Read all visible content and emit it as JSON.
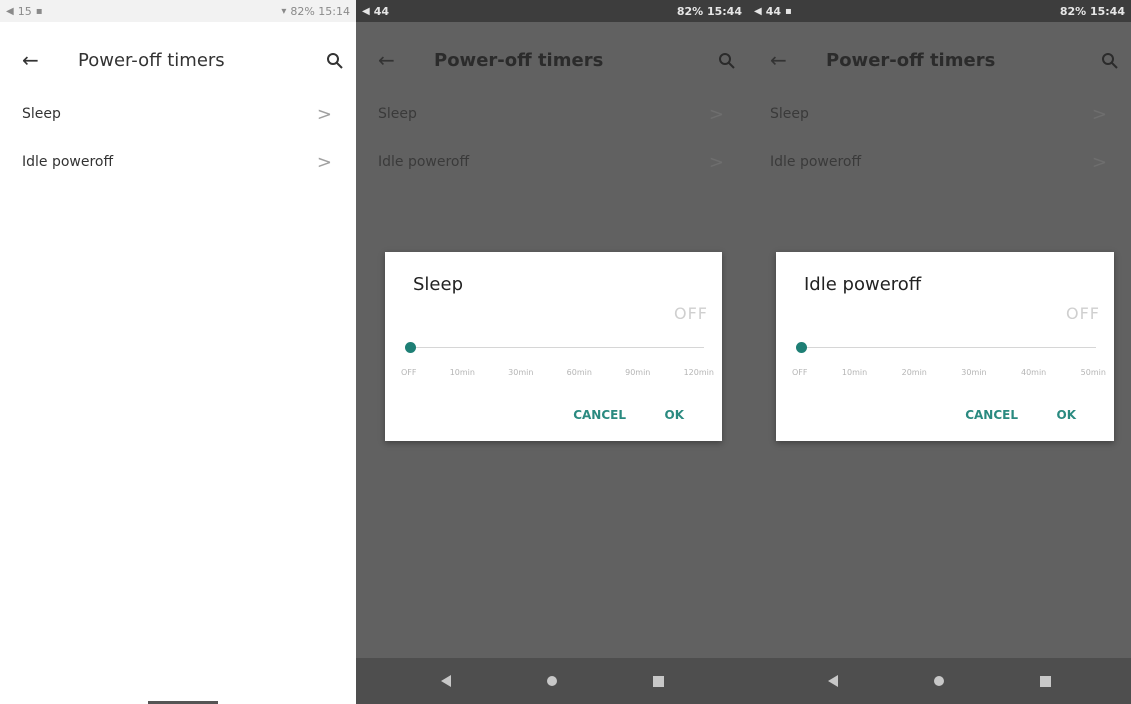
{
  "screens": [
    {
      "status": {
        "left": "15",
        "right": "82% 15:14"
      },
      "title": "Power-off timers",
      "rows": [
        "Sleep",
        "Idle poweroff"
      ]
    },
    {
      "status": {
        "left": "44",
        "right": "82% 15:44"
      },
      "title": "Power-off timers",
      "rows": [
        "Sleep",
        "Idle poweroff"
      ],
      "dialog": {
        "title": "Sleep",
        "value": "OFF",
        "slider_level": 0,
        "ticks": [
          "OFF",
          "10min",
          "30min",
          "60min",
          "90min",
          "120min"
        ],
        "cancel": "CANCEL",
        "ok": "OK"
      }
    },
    {
      "status": {
        "left": "44",
        "right": "82% 15:44"
      },
      "title": "Power-off timers",
      "rows": [
        "Sleep",
        "Idle poweroff"
      ],
      "dialog": {
        "title": "Idle poweroff",
        "value": "OFF",
        "slider_level": 0,
        "ticks": [
          "OFF",
          "10min",
          "20min",
          "30min",
          "40min",
          "50min"
        ],
        "cancel": "CANCEL",
        "ok": "OK"
      }
    }
  ],
  "icons": {
    "back": "arrow-left-icon",
    "search": "search-icon",
    "chevron": "chevron-right-icon",
    "nav": [
      "nav-back-icon",
      "nav-home-icon",
      "nav-recents-icon"
    ]
  },
  "colors": {
    "accent": "#1e7f75",
    "scrim": "#616161"
  }
}
